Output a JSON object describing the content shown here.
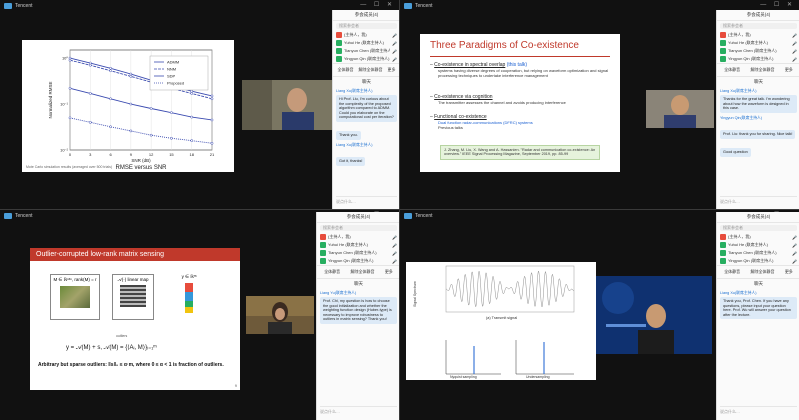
{
  "windows": [
    {
      "title": "Tencent",
      "controls": "— ☐ ✕"
    },
    {
      "title": "Tencent",
      "controls": "— ☐ ✕"
    },
    {
      "title": "Tencent",
      "controls": "— ☐ ✕"
    },
    {
      "title": "Tencent",
      "controls": "— ☐ ✕"
    }
  ],
  "colors": {
    "accent": "#c0392b",
    "chat_bubble": "#ddeaf7",
    "link": "#1a5fd1"
  },
  "panel": {
    "header": "参会成员(4)",
    "search_placeholder": "搜索参会者",
    "mute_all": "全体静音",
    "unmute_all": "解除全体静音",
    "more": "更多",
    "chat_title": "聊天",
    "input_placeholder": "说点什么…",
    "send": "发送",
    "member_list": [
      {
        "name": "(主持人，我)",
        "color": "#e74c3c"
      },
      {
        "name": "Yuhui He (联席主持人)",
        "color": "#27ae60"
      },
      {
        "name": "Tianyun Chen (联席主持人)",
        "color": "#27ae60"
      },
      {
        "name": "Yingyun Qin (联席主持人)",
        "color": "#27ae60"
      }
    ]
  },
  "q1": {
    "chart_data": {
      "type": "line",
      "title": "",
      "xlabel": "SNR (dB)",
      "ylabel": "Normalized RMSE",
      "caption": "RMSE versus SNR",
      "x": [
        0,
        3,
        6,
        9,
        12,
        15,
        18,
        21
      ],
      "xticks": [
        "0",
        "3",
        "6",
        "9",
        "12",
        "15",
        "18",
        "21"
      ],
      "yticks": [
        "10⁰",
        "10⁻¹",
        "10⁻²"
      ],
      "series": [
        {
          "name": "ADMM",
          "values": [
            1.0,
            0.78,
            0.6,
            0.45,
            0.33,
            0.25,
            0.19,
            0.15
          ]
        },
        {
          "name": "NNM",
          "values": [
            0.9,
            0.7,
            0.53,
            0.4,
            0.3,
            0.22,
            0.17,
            0.13
          ]
        },
        {
          "name": "SDP",
          "values": [
            0.22,
            0.17,
            0.13,
            0.1,
            0.08,
            0.065,
            0.052,
            0.045
          ]
        },
        {
          "name": "Proposed",
          "values": [
            0.05,
            0.04,
            0.032,
            0.026,
            0.021,
            0.018,
            0.016,
            0.014
          ]
        }
      ]
    },
    "footer": "Mote Carlo simulation results (averaged over 500 trials)",
    "chat": {
      "sender": "Liang Xu(联席主持人)",
      "message": "Hi Prof. Liu, I'm curious about the complexity of the proposed algorithm compared to ADMM. Could you elaborate on the computational cost per iteration?",
      "reply": "Thank you.",
      "sender2": "Liang Xu(联席主持人)",
      "message2": "Got it, thanks!"
    }
  },
  "q2": {
    "slide_title": "Three Paradigms of Co-existence",
    "bullets": [
      {
        "head": "Co-existence in spectral overlap",
        "link": "(this talk)",
        "sub": "systems having diverse degrees of cooperation, but relying on waveform optimization and signal processing techniques to undertake interference management"
      },
      {
        "head": "Co-existence via cognition",
        "link": "",
        "sub": "The transmitter assesses the channel and avoids producing interference"
      },
      {
        "head": "Functional co-existence",
        "link": "",
        "sub": "Dual function radar-communications (DFRC) systems",
        "sub2": "Previous talks"
      }
    ],
    "citation": "J. Zhang, M. Liu, X. Wang and A. Hassanien. \"Radar and communication co-existence: An overview.\" IEEE Signal Processing Magazine, September 2019, pp. 85-99",
    "chat": {
      "sender": "Liang Xu(联席主持人)",
      "message": "Thanks for the great talk. I'm wondering about how the waveform is designed in this case.",
      "reply_sender": "Yingyun Qin(联席主持人)",
      "reply": "Prof. Liu: thank you for sharing. Nice talk!",
      "reply2": "Good question"
    }
  },
  "q3": {
    "slide_title": "Outlier-corrupted low-rank matrix sensing",
    "left_box": "M ∈ ℝⁿˣⁿ, rank(M) = r",
    "mid_box": "𝒜(·) linear map",
    "right_box": "y ∈ ℝᵐ",
    "outlier_note": "outliers",
    "equation": "y = 𝒜(M) + s,   𝒜(M) = {⟨Aᵢ, M⟩}ᵢ₌₁ᵐ",
    "bottom_text": "Arbitrary but sparse outliers: ‖s‖₀ ≤ α·m, where 0 ≤ α < 1 is fraction of outliers.",
    "page_number": "9",
    "chat": {
      "sender": "Liang Yu(联席主持人)",
      "message": "Prof. Chi, my question is how to choose the good initialization and whether the weighting function design (Huber-type) is necessary to improve robustness to outliers in matrix sensing? Thank you!"
    }
  },
  "q4": {
    "top_label": "(a) Transmit signal",
    "chart_labels": [
      "Nyquist sampling",
      "Undersampling"
    ],
    "bottom_left_label": "Signal Spectrum",
    "chat": {
      "sender": "Liang Xu(联席主持人)",
      "message": "Thank you, Prof. Chen. If you have any questions, please input your question here. Prof. Wu will answer your question after the lecture."
    }
  }
}
